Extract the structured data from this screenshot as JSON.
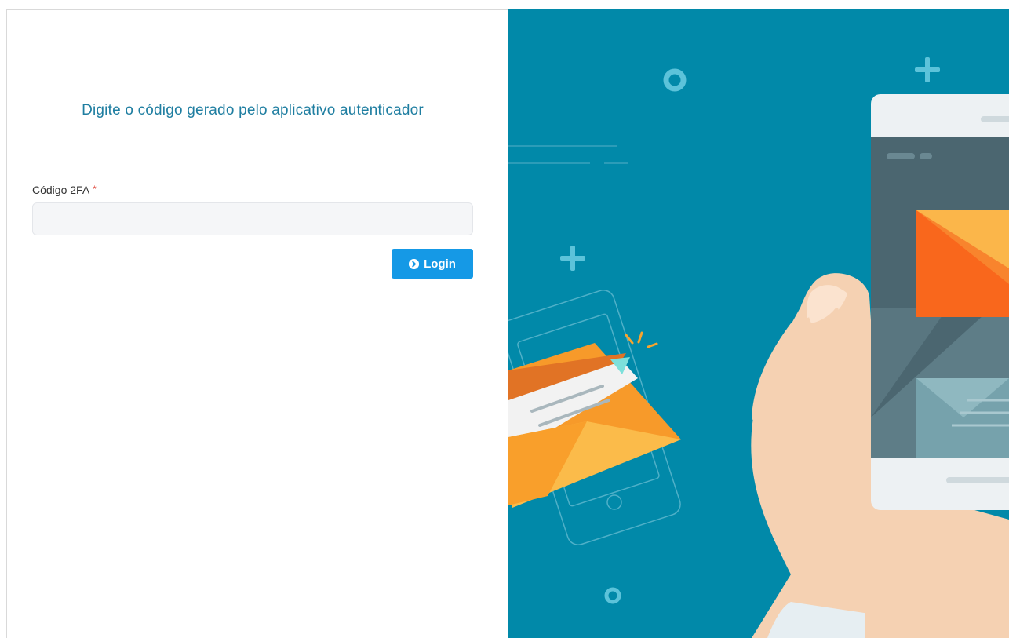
{
  "login": {
    "title": "Digite o código gerado pelo aplicativo autenticador",
    "field_label": "Código 2FA",
    "required_marker": "*",
    "code_input": {
      "value": "",
      "placeholder": ""
    },
    "submit_label": "Login",
    "submit_icon": "chevron-circle-right-icon"
  },
  "colors": {
    "title": "#1f7ea1",
    "button": "#1599e6",
    "illustration_bg": "#0189a9",
    "required": "#e2574c"
  }
}
